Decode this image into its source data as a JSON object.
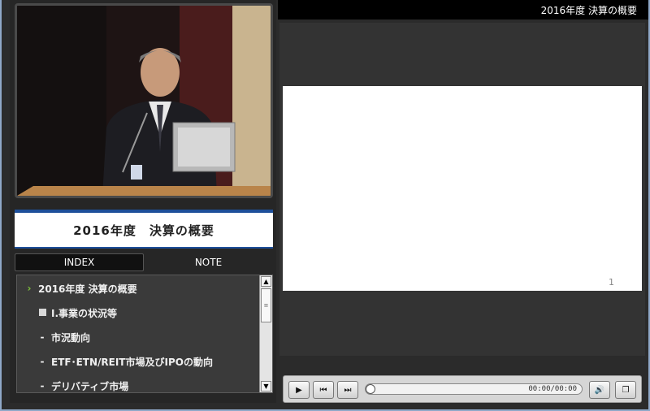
{
  "header": {
    "title": "2016年度 決算の概要"
  },
  "slide_title": "2016年度　決算の概要",
  "tabs": [
    {
      "label": "INDEX",
      "active": true
    },
    {
      "label": "NOTE",
      "active": false
    }
  ],
  "index": [
    {
      "marker": "chevron",
      "text": "2016年度 決算の概要"
    },
    {
      "marker": "square",
      "text": "Ⅰ.事業の状況等"
    },
    {
      "marker": "dash",
      "text": "市況動向"
    },
    {
      "marker": "dash",
      "text": "ETF･ETN/REIT市場及びIPOの動向"
    },
    {
      "marker": "dash",
      "text": "デリバティブ市場"
    }
  ],
  "slide": {
    "page_number": "1"
  },
  "player": {
    "time": "00:00/00:00"
  },
  "colors": {
    "accent_green": "#7ec23a",
    "title_blue": "#1d4f9a"
  }
}
